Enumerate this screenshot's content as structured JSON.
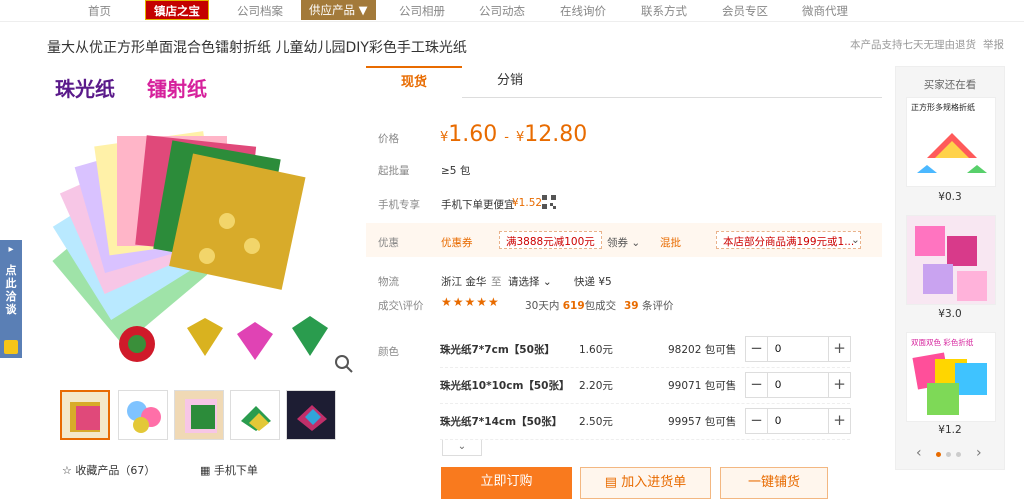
{
  "nav": {
    "items": [
      "首页",
      "公司档案",
      "公司相册",
      "公司动态",
      "在线询价",
      "联系方式",
      "会员专区",
      "微商代理"
    ],
    "badge": "镇店之宝",
    "supply": "供应产品 ▼"
  },
  "product": {
    "title": "量大从优正方形单面混合色镭射折纸 儿童幼儿园DIY彩色手工珠光纸",
    "notice": "本产品支持七天无理由退货",
    "report": "举报",
    "hero_text_1": "珠光纸",
    "hero_text_2": "镭射纸"
  },
  "tabs": [
    "现货",
    "分销"
  ],
  "pricing": {
    "price_label": "价格",
    "currency": "¥",
    "price_low": "1.60",
    "dash": "-",
    "price_high": "12.80",
    "moq_label": "起批量",
    "moq_value": "≥5 包",
    "mobile_label": "手机专享",
    "mobile_text": "手机下单更便宜",
    "mobile_price": "¥1.52"
  },
  "promo": {
    "label": "优惠",
    "coupon_label": "优惠券",
    "coupon_text": "满3888元减100元",
    "claim": "领券",
    "mix_label": "混批",
    "mix_text": "本店部分商品满199元或1..."
  },
  "logistics": {
    "label": "物流",
    "origin": "浙江 金华",
    "to": "至",
    "select": "请选择",
    "express": "快递 ¥5"
  },
  "reviews": {
    "label": "成交\\评价",
    "stars": "★★★★★",
    "days_text_a": "30天内",
    "count": "619",
    "days_text_b": "包成交",
    "review_count": "39",
    "review_text": "条评价"
  },
  "sku": {
    "label": "颜色",
    "rows": [
      {
        "name": "珠光纸7*7cm【50张】",
        "price": "1.60元",
        "stock": "98202 包可售",
        "qty": "0"
      },
      {
        "name": "珠光纸10*10cm【50张】",
        "price": "2.20元",
        "stock": "99071 包可售",
        "qty": "0"
      },
      {
        "name": "珠光纸7*14cm【50张】",
        "price": "2.50元",
        "stock": "99957 包可售",
        "qty": "0"
      }
    ]
  },
  "buttons": {
    "buy": "立即订购",
    "cart": "加入进货单",
    "distribute": "一键铺货"
  },
  "gallery": {
    "favorite": "收藏产品（67）",
    "mobile_order": "手机下单"
  },
  "sidebar": {
    "header": "买家还在看",
    "items": [
      {
        "caption": "正方形多规格折纸",
        "price": "¥0.3"
      },
      {
        "caption": "",
        "price": "¥3.0"
      },
      {
        "caption": "双面双色 彩色折纸",
        "price": "¥1.2"
      }
    ]
  },
  "floatbar": {
    "text": "点此洽谈"
  },
  "colors": {
    "accent": "#e86b00",
    "buy": "#f97a1e",
    "badge": "#c40000"
  }
}
